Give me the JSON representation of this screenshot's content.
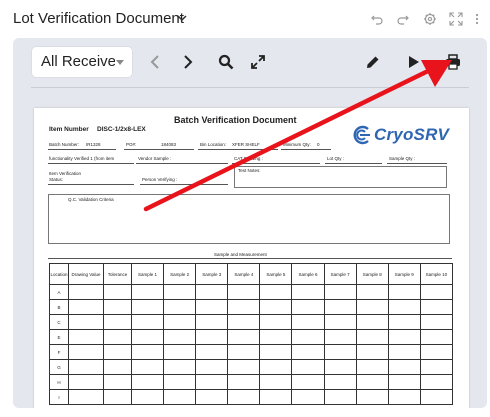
{
  "header": {
    "title": "Lot Verification Document",
    "icons": [
      "chevron-down-icon",
      "undo-icon",
      "redo-icon",
      "settings-icon",
      "fullscreen-icon"
    ]
  },
  "toolbar": {
    "receiver_select": {
      "value": "All Receivers"
    },
    "icons": [
      "previous-icon",
      "next-icon",
      "search-icon",
      "expand-icon",
      "edit-icon",
      "play-icon",
      "print-icon"
    ]
  },
  "document": {
    "title": "Batch Verification Document",
    "item_number_label": "Item Number",
    "item_number_value": "DISC-1/2x8-LEX",
    "logo_text": "CryoSRV",
    "row1": {
      "batch_number_label": "Batch Number:",
      "batch_number_value": "IR1328",
      "po_label": "PO#:",
      "po_value": "184083",
      "bin_location_label": "Bin Location:",
      "bin_location_value": "XFER SHELF",
      "minimum_qty_label": "Minimum Qty:",
      "minimum_qty_value": "0"
    },
    "row2": {
      "functionality_label": "functionality Verified 1 (from item",
      "vendor_sample_label": "Vendor Sample :",
      "cat_drawing_label": "CAT Drawing :",
      "lot_qty_label": "Lot Qty :",
      "sample_qty_label": "Sample Qty :"
    },
    "row3": {
      "item_verification_label": "Item Verification",
      "status_label": "Status:",
      "person_verifying_label": "Person Verifying :",
      "test_notes_label": "Test Notes:"
    },
    "qc_label": "Q.C. Validation Criteria",
    "sample_title": "Sample and Measurement",
    "table": {
      "headers": [
        "Location",
        "Drawing Value",
        "Tolerance",
        "Sample 1",
        "Sample 2",
        "Sample 3",
        "Sample 4",
        "Sample 5",
        "Sample 6",
        "Sample 7",
        "Sample 8",
        "Sample 9",
        "Sample 10"
      ],
      "rows": [
        "A",
        "B",
        "C",
        "E",
        "F",
        "G",
        "H",
        "I"
      ]
    }
  },
  "colors": {
    "panel_bg": "#e4e7ee",
    "logo_blue": "#2f66b3",
    "annotation_arrow": "#e8131b"
  }
}
